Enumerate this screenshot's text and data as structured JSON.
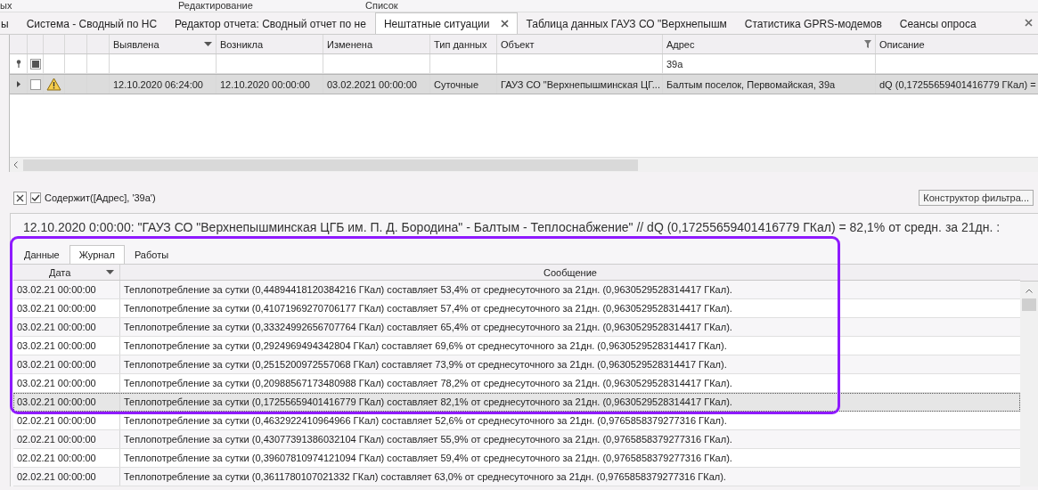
{
  "ribbon_groups": [
    "ых",
    "Редактирование",
    "Список"
  ],
  "document_tabs": [
    {
      "label": "ы",
      "selected": false
    },
    {
      "label": "Система - Сводный по НС",
      "selected": false
    },
    {
      "label": "Редактор отчета: Сводный отчет по не",
      "selected": false
    },
    {
      "label": "Нештатные ситуации",
      "selected": true
    },
    {
      "label": "Таблица данных ГАУЗ СО \"Верхнепышм",
      "selected": false
    },
    {
      "label": "Статистика GPRS-модемов",
      "selected": false
    },
    {
      "label": "Сеансы опроса",
      "selected": false
    }
  ],
  "grid": {
    "columns": [
      {
        "label": "Выявлена",
        "kind": "sorted"
      },
      {
        "label": "Возникла",
        "kind": "plain"
      },
      {
        "label": "Изменена",
        "kind": "plain"
      },
      {
        "label": "Тип данных",
        "kind": "plain"
      },
      {
        "label": "Объект",
        "kind": "plain"
      },
      {
        "label": "Адрес",
        "kind": "filtered"
      },
      {
        "label": "Описание",
        "kind": "plain"
      }
    ],
    "filter_row": {
      "checked": true,
      "address_filter": "39а"
    },
    "rows": [
      {
        "checked": false,
        "selected": true,
        "cells": [
          "12.10.2020 06:24:00",
          "12.10.2020 00:00:00",
          "03.02.2021 00:00:00",
          "Суточные",
          "ГАУЗ СО \"Верхнепышминская ЦГ...",
          "Балтым поселок, Первомайская, 39а",
          "dQ (0,17255659401416779 ГКал) ="
        ]
      }
    ]
  },
  "filter_panel": {
    "enabled": true,
    "expression": "Содержит([Адрес], '39а')",
    "button": "Конструктор фильтра..."
  },
  "caption": "12.10.2020 0:00:00: \"ГАУЗ СО \"Верхнепышминская ЦГБ им. П. Д. Бородина\" - Балтым - Теплоснабжение\" // dQ (0,17255659401416779 ГКал) = 82,1% от средн. за 21дн. :",
  "detail_tabs": [
    {
      "label": "Данные",
      "selected": false
    },
    {
      "label": "Журнал",
      "selected": true
    },
    {
      "label": "Работы",
      "selected": false
    }
  ],
  "journal": {
    "columns": [
      "Дата",
      "Сообщение"
    ],
    "rows": [
      {
        "date": "03.02.21 00:00:00",
        "message": "Теплопотребление за сутки (0,44894418120384216 ГКал) составляет 53,4% от среднесуточного за 21дн. (0,9630529528314417 ГКал).",
        "selected": false
      },
      {
        "date": "03.02.21 00:00:00",
        "message": "Теплопотребление за сутки (0,41071969270706177 ГКал) составляет 57,4% от среднесуточного за 21дн. (0,9630529528314417 ГКал).",
        "selected": false
      },
      {
        "date": "03.02.21 00:00:00",
        "message": "Теплопотребление за сутки (0,33324992656707764 ГКал) составляет 65,4% от среднесуточного за 21дн. (0,9630529528314417 ГКал).",
        "selected": false
      },
      {
        "date": "03.02.21 00:00:00",
        "message": "Теплопотребление за сутки (0,2924969494342804 ГКал) составляет 69,6% от среднесуточного за 21дн. (0,9630529528314417 ГКал).",
        "selected": false
      },
      {
        "date": "03.02.21 00:00:00",
        "message": "Теплопотребление за сутки (0,2515200972557068 ГКал) составляет 73,9% от среднесуточного за 21дн. (0,9630529528314417 ГКал).",
        "selected": false
      },
      {
        "date": "03.02.21 00:00:00",
        "message": "Теплопотребление за сутки (0,20988567173480988 ГКал) составляет 78,2% от среднесуточного за 21дн. (0,9630529528314417 ГКал).",
        "selected": false
      },
      {
        "date": "03.02.21 00:00:00",
        "message": "Теплопотребление за сутки (0,17255659401416779 ГКал) составляет 82,1% от среднесуточного за 21дн. (0,9630529528314417 ГКал).",
        "selected": true
      },
      {
        "date": "02.02.21 00:00:00",
        "message": "Теплопотребление за сутки (0,4632922410964966 ГКал) составляет 52,6% от среднесуточного за 21дн. (0,9765858379277316 ГКал).",
        "selected": false
      },
      {
        "date": "02.02.21 00:00:00",
        "message": "Теплопотребление за сутки (0,43077391386032104 ГКал) составляет 55,9% от среднесуточного за 21дн. (0,9765858379277316 ГКал).",
        "selected": false
      },
      {
        "date": "02.02.21 00:00:00",
        "message": "Теплопотребление за сутки (0,39607810974121094 ГКал) составляет 59,4% от среднесуточного за 21дн. (0,9765858379277316 ГКал).",
        "selected": false
      },
      {
        "date": "02.02.21 00:00:00",
        "message": "Теплопотребление за сутки (0,3611780107021332 ГКал) составляет 63,0% от среднесуточного за 21дн. (0,9765858379277316 ГКал).",
        "selected": false
      }
    ]
  }
}
